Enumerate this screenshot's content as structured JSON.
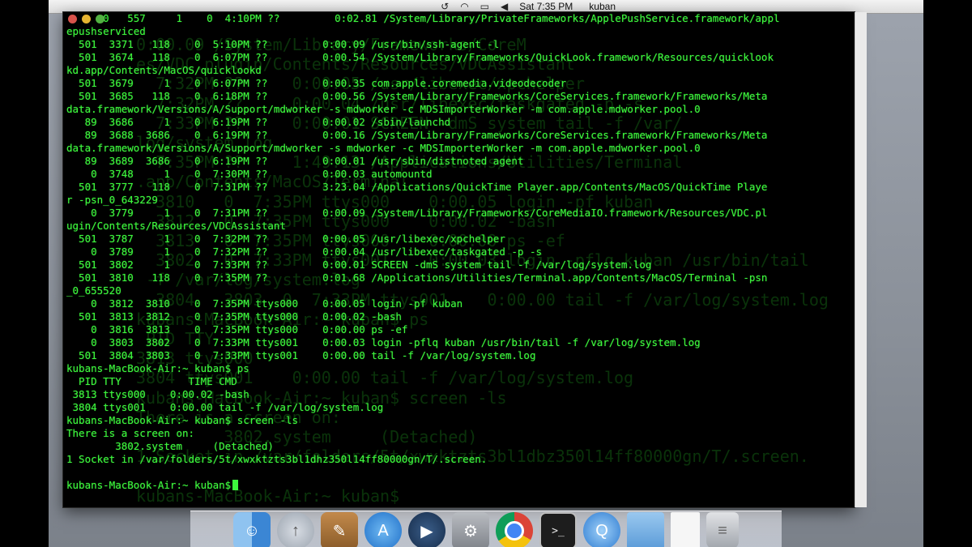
{
  "menubar": {
    "clock": "Sat 7:35 PM",
    "user": "kuban",
    "icons": [
      "time-machine-icon",
      "wifi-icon",
      "battery-icon",
      "volume-icon"
    ]
  },
  "terminal": {
    "lines": [
      "      0   557     1    0  4:10PM ??         0:02.81 /System/Library/PrivateFrameworks/ApplePushService.framework/appl",
      "epushserviced",
      "  501  3371   118    0  5:10PM ??         0:00.09 /usr/bin/ssh-agent -l",
      "  501  3674   118    0  6:07PM ??         0:00.54 /System/Library/Frameworks/QuickLook.framework/Resources/quicklook",
      "kd.app/Contents/MacOS/quicklookd",
      "  501  3679     1    0  6:07PM ??         0:00.35 com.apple.coremedia.videodecoder",
      "  501  3685   118    0  6:18PM ??         0:00.56 /System/Library/Frameworks/CoreServices.framework/Frameworks/Meta",
      "data.framework/Versions/A/Support/mdworker -s mdworker -c MDSImporterWorker -m com.apple.mdworker.pool.0",
      "   89  3686     1    0  6:19PM ??         0:00.02 /sbin/launchd",
      "   89  3688  3686    0  6:19PM ??         0:00.16 /System/Library/Frameworks/CoreServices.framework/Frameworks/Meta",
      "data.framework/Versions/A/Support/mdworker -s mdworker -c MDSImporterWorker -m com.apple.mdworker.pool.0",
      "   89  3689  3686    0  6:19PM ??         0:00.01 /usr/sbin/distnoted agent",
      "    0  3748     1    0  7:30PM ??         0:00.03 automountd",
      "  501  3777   118    0  7:31PM ??         3:23.04 /Applications/QuickTime Player.app/Contents/MacOS/QuickTime Playe",
      "r -psn_0_643229",
      "    0  3779     1    0  7:31PM ??         0:00.09 /System/Library/Frameworks/CoreMediaIO.framework/Resources/VDC.pl",
      "ugin/Contents/Resources/VDCAssistant",
      "  501  3787     1    0  7:32PM ??         0:00.05 /usr/libexec/xpchelper",
      "    0  3789     1    0  7:32PM ??         0:00.04 /usr/libexec/taskgated -p -s",
      "  501  3802     1    0  7:33PM ??         0:00.01 SCREEN -dmS system tail -f /var/log/system.log",
      "  501  3810   118    0  7:35PM ??         0:01.68 /Applications/Utilities/Terminal.app/Contents/MacOS/Terminal -psn",
      "_0_655520",
      "    0  3812  3810    0  7:35PM ttys000    0:00.05 login -pf kuban",
      "  501  3813  3812    0  7:35PM ttys000    0:00.02 -bash",
      "    0  3816  3813    0  7:35PM ttys000    0:00.00 ps -ef",
      "    0  3803  3802    0  7:33PM ttys001    0:00.03 login -pflq kuban /usr/bin/tail -f /var/log/system.log",
      "  501  3804  3803    0  7:33PM ttys001    0:00.00 tail -f /var/log/system.log",
      "kubans-MacBook-Air:~ kuban$ ps",
      "  PID TTY           TIME CMD",
      " 3813 ttys000    0:00.02 -bash",
      " 3804 ttys001    0:00.00 tail -f /var/log/system.log",
      "kubans-MacBook-Air:~ kuban$ screen -ls",
      "There is a screen on:",
      "        3802.system     (Detached)",
      "1 Socket in /var/folders/5t/xwxktzts3bl1dhz350l14ff80000gn/T/.screen.",
      ""
    ],
    "prompt": "kubans-MacBook-Air:~ kuban$",
    "ghost_text": "0:00.09 /System/Library/Frameworks/CoreM\nes/VDC.plugin/Contents/Resources/VDCAssistant\n  7:32PM ??     0:00.05 /usr/libexec/xpchelper\n  7:32PM ??     0:00.04 /usr/libexec/taskgated -p -s\n  7:33PM ??     0:00.01 SCREEN -dmS system tail -f /var/\nlog/system.log\n  7:35PM ??     1:49.13 /Applications/Utilities/Terminal\n.app/Contents/MacOS/Terminal\n  3810   0  7:35PM ttys000    0:00.05 login -pf kuban\n  3812   0  7:35PM ttys000    0:00.02 -bash\n  3813   0  7:35PM ttys000    0:00.00 ps -ef\n  3802   0  7:33PM ttys001    0:00.03 login -pflq kuban /usr/bin/tail\n -f /var/log/system.log\n  3804   3803  0  7:33PM ttys001    0:00.00 tail -f /var/log/system.log\nkubans-MacBook-Air:~ kuban$ ps\n PID TTY\n3813 ttys000\n3804 ttys001    0:00.00 tail -f /var/log/system.log\nkubans-MacBook-Air:~ kuban$ screen -ls\nThere is a screen on:\n         3802.system     (Detached)\n1 Socket in /var/folders/5t/xwxktzts3bl1dbz350l14ff80000gn/T/.screen.\n\nkubans-MacBook-Air:~ kuban$"
  },
  "dock": {
    "items": [
      {
        "name": "finder-icon"
      },
      {
        "name": "launchpad-icon"
      },
      {
        "name": "pages-icon"
      },
      {
        "name": "app-store-icon"
      },
      {
        "name": "quicktime-icon"
      },
      {
        "name": "system-preferences-icon"
      },
      {
        "name": "chrome-icon"
      },
      {
        "name": "terminal-icon"
      },
      {
        "name": "quicktime-player-icon"
      },
      {
        "name": "folder-icon"
      },
      {
        "name": "document-icon"
      },
      {
        "name": "trash-icon"
      }
    ]
  },
  "colors": {
    "terminal_text": "#3df53d",
    "terminal_bg": "#000000"
  }
}
